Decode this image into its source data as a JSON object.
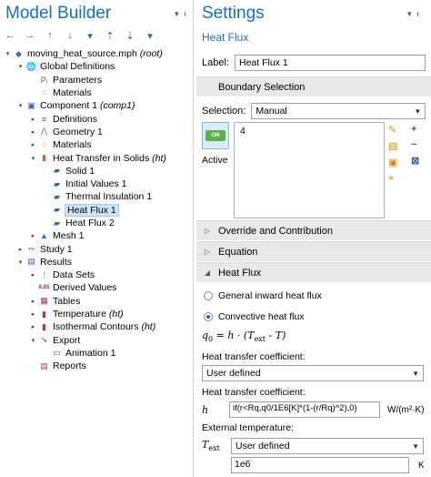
{
  "model_builder": {
    "title": "Model Builder",
    "pin_glyph": "▾",
    "close_glyph": "ᵻ",
    "toolbar": [
      "←",
      "→",
      "↑",
      "↓",
      "▾",
      "⇡",
      "⇣",
      "▾"
    ],
    "tree": [
      {
        "label": "moving_heat_source.mph",
        "suffix": " (root)",
        "icon": "mph-file-icon",
        "glyph": "◆",
        "color": "#3a6db5",
        "level": 0,
        "expander": "▾"
      },
      {
        "label": "Global Definitions",
        "suffix": "",
        "icon": "globe-icon",
        "glyph": "🌐",
        "color": "#4a7fc0",
        "level": 1,
        "expander": "▾"
      },
      {
        "label": "Parameters",
        "suffix": "",
        "icon": "parameters-icon",
        "glyph": "Pᵢ",
        "color": "#2d63a8",
        "level": 2,
        "expander": ""
      },
      {
        "label": "Materials",
        "suffix": "",
        "icon": "materials-icon",
        "glyph": "⁘",
        "color": "#e08a1a",
        "level": 2,
        "expander": ""
      },
      {
        "label": "Component 1",
        "suffix": " (comp1)",
        "icon": "component-icon",
        "glyph": "▣",
        "color": "#2d63a8",
        "level": 1,
        "expander": "▾"
      },
      {
        "label": "Definitions",
        "suffix": "",
        "icon": "definitions-icon",
        "glyph": "≡",
        "color": "#2d63a8",
        "level": 2,
        "expander": "▸"
      },
      {
        "label": "Geometry 1",
        "suffix": "",
        "icon": "geometry-icon",
        "glyph": "⋀",
        "color": "#d0642a",
        "level": 2,
        "expander": "▸"
      },
      {
        "label": "Materials",
        "suffix": "",
        "icon": "materials-icon",
        "glyph": "⁘",
        "color": "#e08a1a",
        "level": 2,
        "expander": "▸"
      },
      {
        "label": "Heat Transfer in Solids",
        "suffix": " (ht)",
        "icon": "heat-transfer-icon",
        "glyph": "▮",
        "color": "#d0642a",
        "level": 2,
        "expander": "▾"
      },
      {
        "label": "Solid 1",
        "suffix": "",
        "icon": "solid-icon",
        "glyph": "▰",
        "color": "#2d63a8",
        "level": 3,
        "expander": ""
      },
      {
        "label": "Initial Values 1",
        "suffix": "",
        "icon": "initial-values-icon",
        "glyph": "▰",
        "color": "#2d63a8",
        "level": 3,
        "expander": ""
      },
      {
        "label": "Thermal Insulation 1",
        "suffix": "",
        "icon": "thermal-insulation-icon",
        "glyph": "▰",
        "color": "#2d63a8",
        "level": 3,
        "expander": ""
      },
      {
        "label": "Heat Flux 1",
        "suffix": "",
        "icon": "heat-flux-icon",
        "glyph": "▰",
        "color": "#2d63a8",
        "level": 3,
        "expander": "",
        "selected": true
      },
      {
        "label": "Heat Flux 2",
        "suffix": "",
        "icon": "heat-flux-icon",
        "glyph": "▰",
        "color": "#2d63a8",
        "level": 3,
        "expander": ""
      },
      {
        "label": "Mesh 1",
        "suffix": "",
        "icon": "mesh-icon",
        "glyph": "▲",
        "color": "#3a6db5",
        "level": 2,
        "expander": "▸"
      },
      {
        "label": "Study 1",
        "suffix": "",
        "icon": "study-icon",
        "glyph": "∾",
        "color": "#2d63a8",
        "level": 1,
        "expander": "▸"
      },
      {
        "label": "Results",
        "suffix": "",
        "icon": "results-icon",
        "glyph": "▤",
        "color": "#2d63a8",
        "level": 1,
        "expander": "▾"
      },
      {
        "label": "Data Sets",
        "suffix": "",
        "icon": "data-sets-icon",
        "glyph": "⁞",
        "color": "#b05aa8",
        "level": 2,
        "expander": "▸"
      },
      {
        "label": "Derived Values",
        "suffix": "",
        "icon": "derived-values-icon",
        "glyph": "8.85",
        "color": "#b02a7a",
        "level": 2,
        "expander": ""
      },
      {
        "label": "Tables",
        "suffix": "",
        "icon": "tables-icon",
        "glyph": "▦",
        "color": "#b02a7a",
        "level": 2,
        "expander": "▸"
      },
      {
        "label": "Temperature",
        "suffix": " (ht)",
        "icon": "temperature-plot-icon",
        "glyph": "▮",
        "color": "#b02a7a",
        "level": 2,
        "expander": "▸"
      },
      {
        "label": "Isothermal Contours",
        "suffix": " (ht)",
        "icon": "contour-plot-icon",
        "glyph": "▮",
        "color": "#b02a7a",
        "level": 2,
        "expander": "▸"
      },
      {
        "label": "Export",
        "suffix": "",
        "icon": "export-icon",
        "glyph": "➘",
        "color": "#b02a7a",
        "level": 2,
        "expander": "▾"
      },
      {
        "label": "Animation 1",
        "suffix": "",
        "icon": "animation-icon",
        "glyph": "▭",
        "color": "#b02a7a",
        "level": 3,
        "expander": ""
      },
      {
        "label": "Reports",
        "suffix": "",
        "icon": "reports-icon",
        "glyph": "▤",
        "color": "#b02a7a",
        "level": 2,
        "expander": ""
      }
    ]
  },
  "settings": {
    "title": "Settings",
    "subtitle": "Heat Flux",
    "pin_glyph": "▾",
    "close_glyph": "ᵻ",
    "label_caption": "Label:",
    "label_value": "Heat Flux 1",
    "boundary_selection": {
      "heading": "Boundary Selection",
      "selection_caption": "Selection:",
      "selection_value": "Manual",
      "active_caption": "Active",
      "toggle_text": "ON",
      "selected_boundaries": "4",
      "side_icons": [
        "✎",
        "▤",
        "▣",
        "⌖"
      ],
      "right_icons": [
        "+",
        "−",
        "⊠"
      ]
    },
    "sections": {
      "override": "Override and Contribution",
      "equation": "Equation",
      "heat_flux": "Heat Flux"
    },
    "options": {
      "general": "General inward heat flux",
      "convective": "Convective heat flux"
    },
    "formula": {
      "lhs": "q",
      "lhs_sub": "0",
      "rhs_prefix": " = h · (T",
      "rhs_sub": "ext",
      "rhs_suffix": " - T)"
    },
    "htc_caption_1": "Heat transfer coefficient:",
    "htc_select": "User defined",
    "htc_caption_2": "Heat transfer coefficient:",
    "htc_var": "h",
    "htc_expression": "if(r<Rq,q0/1E6[K]*(1-(r/Rq)^2),0)",
    "htc_unit": "W/(m²·K)",
    "ext_temp_caption": "External temperature:",
    "ext_var": "T",
    "ext_var_sub": "ext",
    "ext_select": "User defined",
    "ext_value": "1e6",
    "ext_unit": "K"
  }
}
